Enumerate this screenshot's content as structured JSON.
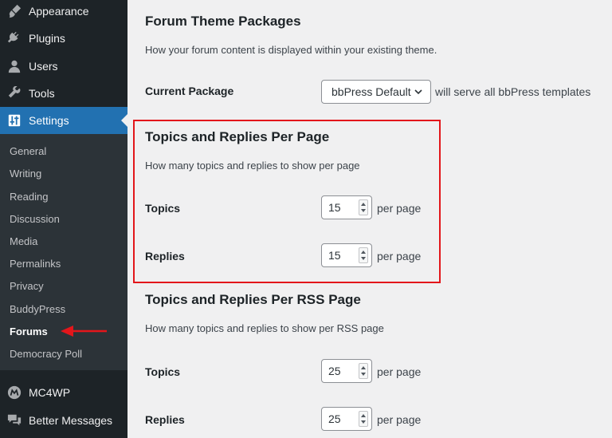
{
  "sidebar": {
    "menu": [
      {
        "label": "Appearance",
        "icon": "paintbrush-icon"
      },
      {
        "label": "Plugins",
        "icon": "plug-icon"
      },
      {
        "label": "Users",
        "icon": "user-icon"
      },
      {
        "label": "Tools",
        "icon": "wrench-icon"
      },
      {
        "label": "Settings",
        "icon": "sliders-icon",
        "active": true
      },
      {
        "label": "MC4WP",
        "icon": "mc4wp-icon"
      },
      {
        "label": "Better Messages",
        "icon": "chat-bubbles-icon"
      }
    ],
    "submenu": [
      "General",
      "Writing",
      "Reading",
      "Discussion",
      "Media",
      "Permalinks",
      "Privacy",
      "BuddyPress",
      "Forums",
      "Democracy Poll"
    ],
    "current_submenu": "Forums"
  },
  "theme_packages": {
    "title": "Forum Theme Packages",
    "description": "How your forum content is displayed within your existing theme.",
    "current_package_label": "Current Package",
    "current_package_value": "bbPress Default",
    "suffix": "will serve all bbPress templates"
  },
  "per_page": {
    "title": "Topics and Replies Per Page",
    "description": "How many topics and replies to show per page",
    "topics_label": "Topics",
    "topics_value": "15",
    "replies_label": "Replies",
    "replies_value": "15",
    "unit": "per page"
  },
  "per_rss_page": {
    "title": "Topics and Replies Per RSS Page",
    "description": "How many topics and replies to show per RSS page",
    "topics_label": "Topics",
    "topics_value": "25",
    "replies_label": "Replies",
    "replies_value": "25",
    "unit": "per page"
  },
  "colors": {
    "sidebar_bg": "#1d2327",
    "submenu_bg": "#2c3338",
    "active_blue": "#2271b1",
    "highlight_red": "#e3161b"
  }
}
